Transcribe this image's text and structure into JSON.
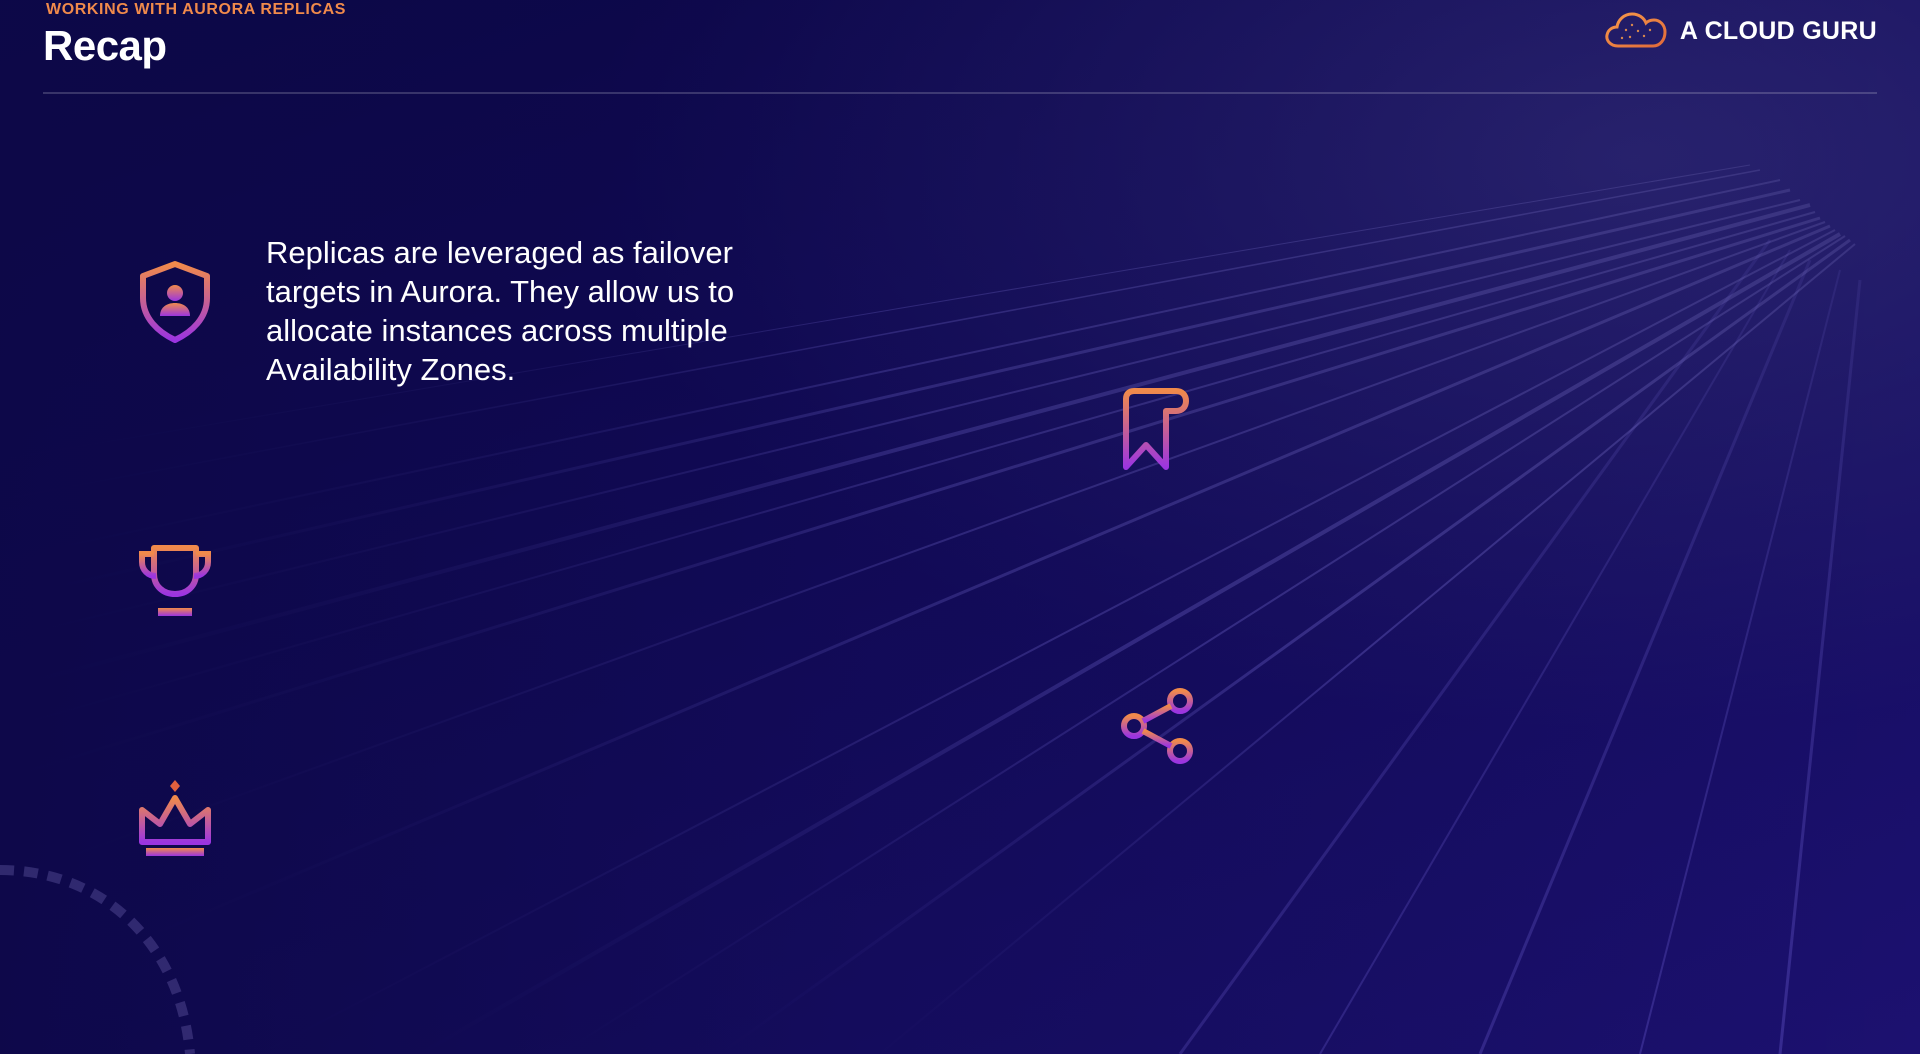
{
  "header": {
    "eyebrow": "WORKING WITH AURORA REPLICAS",
    "title": "Recap"
  },
  "brand": {
    "name": "A CLOUD GURU",
    "logo_icon": "cloud-logo-icon"
  },
  "main": {
    "text": "Replicas are leveraged as failover targets in Aurora. They allow us to allocate instances across multiple Availability Zones."
  },
  "icons": [
    "shield-user-icon",
    "trophy-icon",
    "crown-icon",
    "bookmark-icon",
    "share-icon"
  ],
  "colors": {
    "accent_orange": "#f08a4b",
    "accent_purple": "#a03ce0",
    "background": "#0d0848"
  }
}
